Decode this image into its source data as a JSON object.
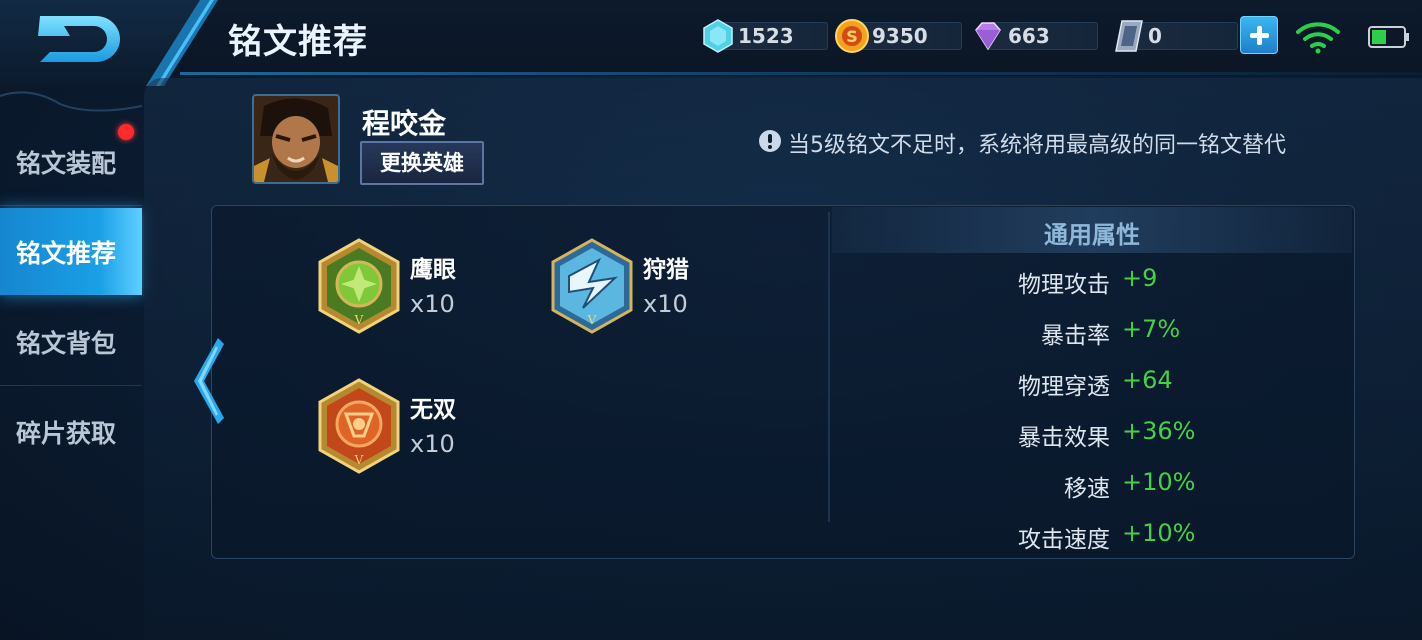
{
  "header": {
    "title": "铭文推荐",
    "resources": [
      {
        "icon": "crystal-icon",
        "value": "1523"
      },
      {
        "icon": "gold-coin-icon",
        "value": "9350"
      },
      {
        "icon": "diamond-icon",
        "value": "663"
      },
      {
        "icon": "voucher-icon",
        "value": "0"
      }
    ]
  },
  "nav": {
    "items": [
      {
        "label": "铭文装配",
        "active": false,
        "badge": true
      },
      {
        "label": "铭文推荐",
        "active": true,
        "badge": false
      },
      {
        "label": "铭文背包",
        "active": false,
        "badge": false
      },
      {
        "label": "碎片获取",
        "active": false,
        "badge": false
      }
    ]
  },
  "hero": {
    "name": "程咬金",
    "swap_label": "更换英雄"
  },
  "notice": "当5级铭文不足时，系统将用最高级的同一铭文替代",
  "runes": [
    {
      "name": "鹰眼",
      "count": "x10",
      "color": "green",
      "level": "V"
    },
    {
      "name": "狩猎",
      "count": "x10",
      "color": "blue",
      "level": "V"
    },
    {
      "name": "无双",
      "count": "x10",
      "color": "red",
      "level": "V"
    }
  ],
  "attributes": {
    "header": "通用属性",
    "rows": [
      {
        "label": "物理攻击",
        "value": "+9"
      },
      {
        "label": "暴击率",
        "value": "+7%"
      },
      {
        "label": "物理穿透",
        "value": "+64"
      },
      {
        "label": "暴击效果",
        "value": "+36%"
      },
      {
        "label": "移速",
        "value": "+10%"
      },
      {
        "label": "攻击速度",
        "value": "+10%"
      }
    ]
  },
  "colors": {
    "accent": "#1aa0e6",
    "positive": "#45d145",
    "badge": "#ff2a2a"
  }
}
